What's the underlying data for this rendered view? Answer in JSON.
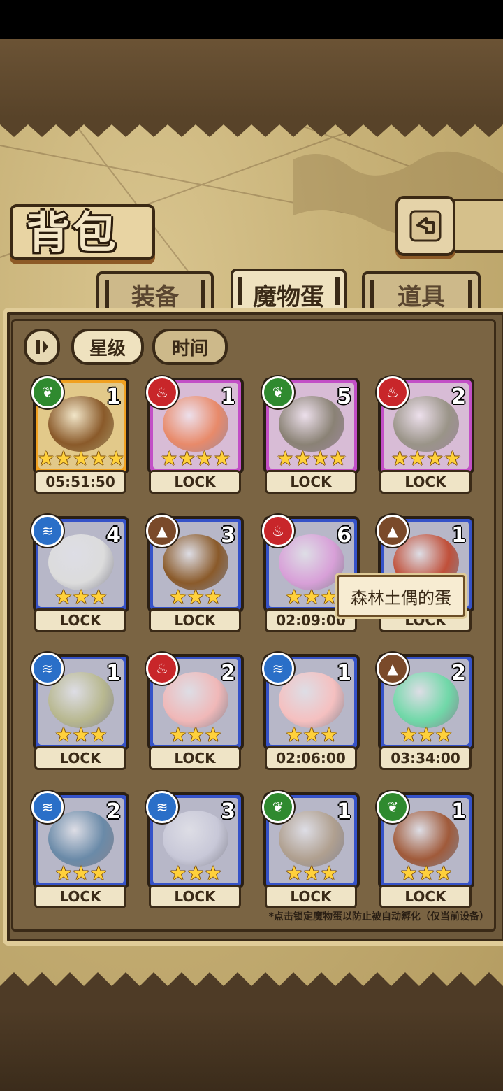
{
  "header": {
    "title": "背包",
    "back_icon": "back-arrow-icon"
  },
  "tabs": [
    {
      "label": "装备",
      "active": false
    },
    {
      "label": "魔物蛋",
      "active": true
    },
    {
      "label": "道具",
      "active": false
    }
  ],
  "sort": {
    "toggle_icon": "sort-direction-icon",
    "star_label": "星级",
    "time_label": "时间"
  },
  "colors": {
    "gold": "#f0a020",
    "purple": "#c24fc6",
    "blue": "#3552c8",
    "nature": "#2f8a2f",
    "fire": "#c8262a",
    "water": "#2a6fc8",
    "earth": "#7a4a2a"
  },
  "items": [
    {
      "element": "nature",
      "rarity": "gold",
      "qty": "1",
      "stars": "★★★★★",
      "status": "05:51:50",
      "art": "lyre"
    },
    {
      "element": "fire",
      "rarity": "purple",
      "qty": "1",
      "stars": "★★★★",
      "status": "LOCK",
      "art": "orb"
    },
    {
      "element": "nature",
      "rarity": "purple",
      "qty": "5",
      "stars": "★★★★",
      "status": "LOCK",
      "art": "kunai"
    },
    {
      "element": "fire",
      "rarity": "purple",
      "qty": "2",
      "stars": "★★★★",
      "status": "LOCK",
      "art": "shield"
    },
    {
      "element": "water",
      "rarity": "blue",
      "qty": "4",
      "stars": "★★★",
      "status": "LOCK",
      "art": "cloud"
    },
    {
      "element": "earth",
      "rarity": "blue",
      "qty": "3",
      "stars": "★★★",
      "status": "LOCK",
      "art": "nest"
    },
    {
      "element": "fire",
      "rarity": "blue",
      "qty": "6",
      "stars": "★★★",
      "status": "02:09:00",
      "art": "mushroom"
    },
    {
      "element": "earth",
      "rarity": "blue",
      "qty": "1",
      "stars": "★★★",
      "status": "LOCK",
      "art": "helmet"
    },
    {
      "element": "water",
      "rarity": "blue",
      "qty": "1",
      "stars": "★★★",
      "status": "LOCK",
      "art": "spiky-egg"
    },
    {
      "element": "fire",
      "rarity": "blue",
      "qty": "2",
      "stars": "★★★",
      "status": "LOCK",
      "art": "pink-egg"
    },
    {
      "element": "water",
      "rarity": "blue",
      "qty": "1",
      "stars": "★★★",
      "status": "02:06:00",
      "art": "peach"
    },
    {
      "element": "earth",
      "rarity": "blue",
      "qty": "2",
      "stars": "★★★",
      "status": "03:34:00",
      "art": "slime"
    },
    {
      "element": "water",
      "rarity": "blue",
      "qty": "2",
      "stars": "★★★",
      "status": "LOCK",
      "art": "eye-egg"
    },
    {
      "element": "water",
      "rarity": "blue",
      "qty": "3",
      "stars": "★★★",
      "status": "LOCK",
      "art": "crystal"
    },
    {
      "element": "nature",
      "rarity": "blue",
      "qty": "1",
      "stars": "★★★",
      "status": "LOCK",
      "art": "viking-egg"
    },
    {
      "element": "nature",
      "rarity": "blue",
      "qty": "1",
      "stars": "★★★",
      "status": "LOCK",
      "art": "nest-egg"
    }
  ],
  "tooltip": "森林土偶的蛋",
  "footnote": "*点击锁定魔物蛋以防止被自动孵化（仅当前设备）"
}
